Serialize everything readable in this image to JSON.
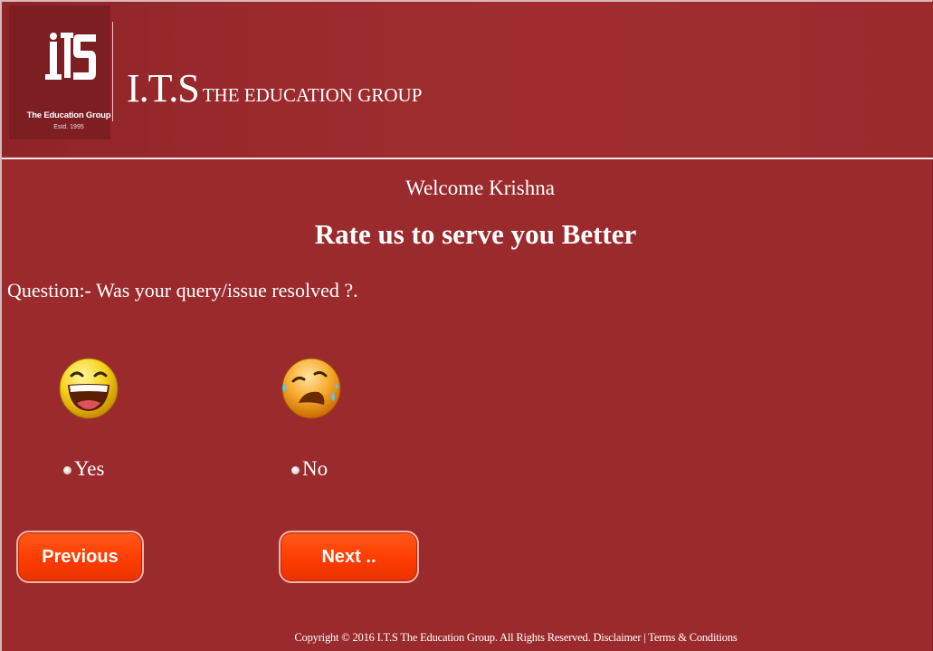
{
  "header": {
    "logo_caption": "The Education Group",
    "logo_estd": "Estd. 1995",
    "brand_main": "I.T.S",
    "brand_sub": "THE EDUCATION GROUP"
  },
  "welcome": "Welcome Krishna",
  "tagline": "Rate us to serve you Better",
  "question": "Question:- Was your query/issue resolved ?.",
  "options": [
    {
      "label": "Yes",
      "icon": "laughing-smiley-icon"
    },
    {
      "label": "No",
      "icon": "crying-smiley-icon"
    }
  ],
  "buttons": {
    "previous": "Previous",
    "next": "Next .."
  },
  "footer": {
    "copyright": "Copyright © 2016 I.T.S The Education Group. All Rights Reserved.",
    "disclaimer": "Disclaimer",
    "separator": "|",
    "terms": "Terms & Conditions"
  },
  "colors": {
    "background": "#9b2a2d",
    "button": "#ff3c00"
  }
}
